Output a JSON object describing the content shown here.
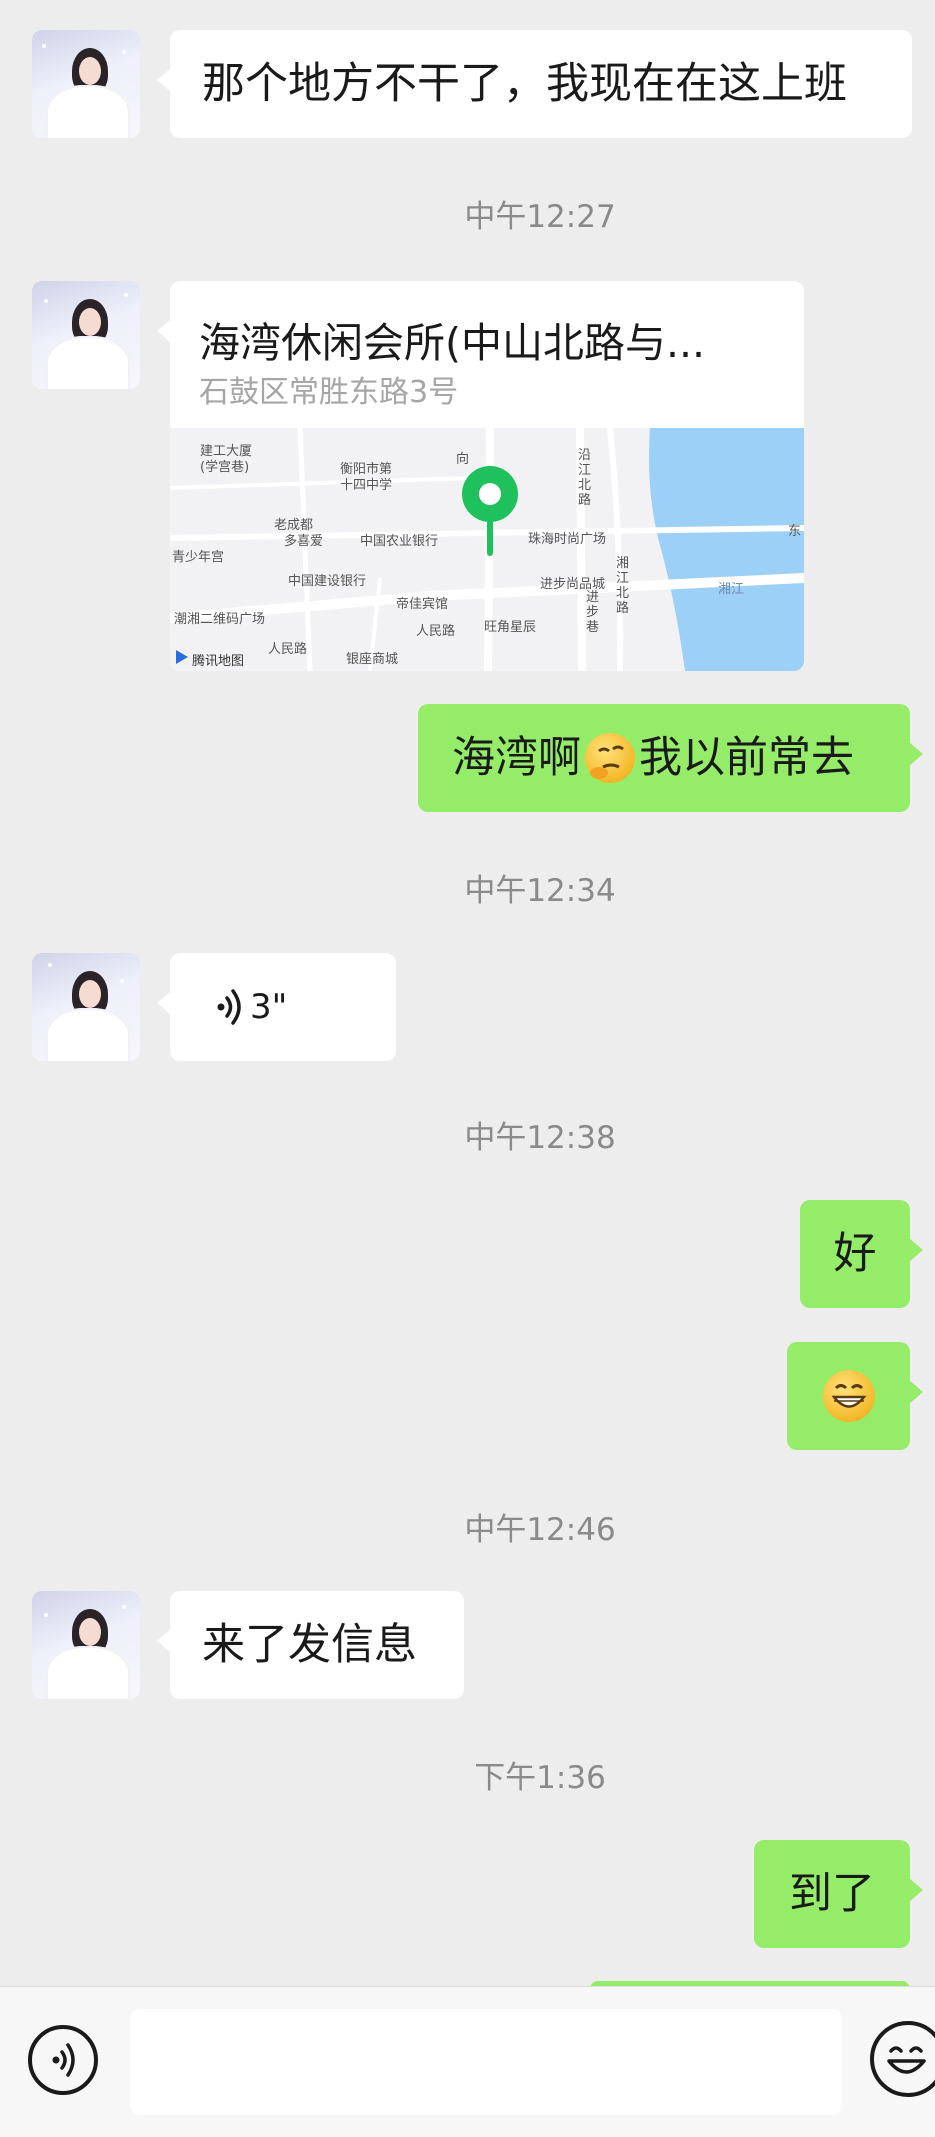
{
  "messages": {
    "m1": {
      "text": "那个地方不干了，我现在在这上班"
    },
    "t1": "中午12:27",
    "location": {
      "title": "海湾休闲会所(中山北路与...",
      "address": "石鼓区常胜东路3号",
      "map_labels": {
        "l1": "建工大厦",
        "l2": "(学宫巷)",
        "l3": "衡阳市第",
        "l4": "十四中学",
        "l5": "老成都",
        "l6": "多喜爱",
        "l7": "中国农业银行",
        "l8": "青少年宫",
        "l9": "中国建设银行",
        "l10": "帝佳宾馆",
        "l11": "潮湘二维码广场",
        "l12": "人民路",
        "l13": "人民路",
        "l14": "旺角星辰",
        "l15": "银座商城",
        "l16": "珠海时尚广场",
        "l17": "进步尚品城",
        "l18": "沿江北路",
        "l19": "湘江北路",
        "l20": "进步巷",
        "l21": "湘江",
        "l22": "东",
        "l23": "向",
        "l24": "腾讯地图"
      }
    },
    "m3": {
      "text": "海湾啊",
      "text2": "我以前常去"
    },
    "t2": "中午12:34",
    "voice": {
      "duration": "3\""
    },
    "t3": "中午12:38",
    "m5": {
      "text": "好"
    },
    "t4": "中午12:46",
    "m7": {
      "text": "来了发信息"
    },
    "t5": "下午1:36",
    "m8": {
      "text": "到了"
    }
  },
  "input": {
    "value": ""
  },
  "icons": {
    "voice": "voice-input-icon",
    "emoji": "emoji-icon",
    "sound": "sound-wave-icon",
    "pin": "location-pin-icon"
  },
  "colors": {
    "bg": "#ededed",
    "sent": "#95ec69",
    "received": "#ffffff",
    "pin": "#1ec15b"
  }
}
